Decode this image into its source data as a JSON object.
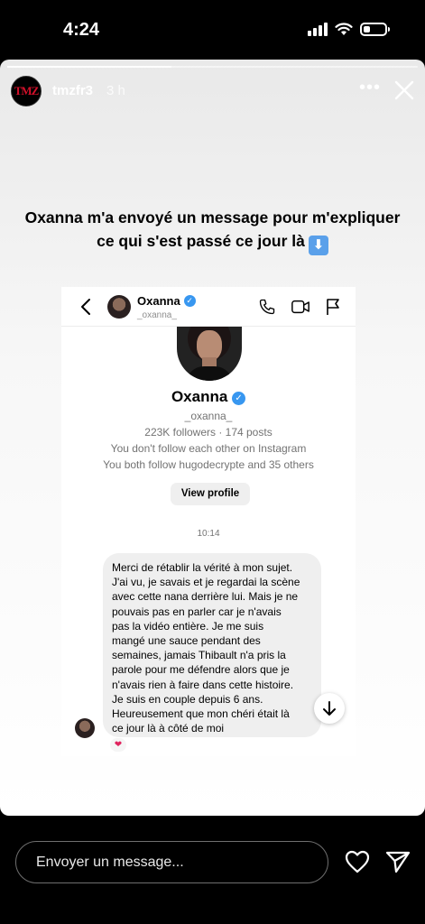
{
  "status_bar": {
    "time": "4:24"
  },
  "story": {
    "username": "tmzfr3",
    "time_ago": "3 h",
    "avatar_text": "TMZ",
    "more_label": "•••",
    "caption_text": "Oxanna m'a envoyé un message pour m'expliquer ce qui s'est passé ce jour là",
    "caption_emoji": "⬇"
  },
  "dm": {
    "top_name": "Oxanna",
    "top_handle": "_oxanna_",
    "profile_name": "Oxanna",
    "profile_handle": "_oxanna_",
    "stats": "223K followers · 174 posts",
    "mutual_line1": "You don't follow each other on Instagram",
    "mutual_line2": "You both follow hugodecrypte and 35 others",
    "view_profile_label": "View profile",
    "timestamp": "10:14",
    "message_lines": [
      "Merci de rétablir la vérité à mon sujet.",
      "J'ai vu, je savais et je regardai la scène",
      "avec cette nana derrière lui. Mais je ne",
      "pouvais pas en parler car je n'avais",
      "pas la vidéo entière. Je me suis",
      "mangé une sauce pendant des",
      "semaines, jamais Thibault n'a pris la",
      "parole pour me défendre alors que je",
      "n'avais rien à faire dans cette histoire.",
      "Je suis en couple depuis 6 ans.",
      "Heureusement que mon chéri était là",
      "ce jour là à côté de moi"
    ],
    "reaction": "❤"
  },
  "reply": {
    "placeholder": "Envoyer un message..."
  },
  "icons": {
    "close": "close-icon",
    "back": "chevron-left-icon",
    "phone": "phone-icon",
    "video": "video-camera-icon",
    "flag": "flag-icon",
    "heart": "heart-icon",
    "send": "send-icon",
    "arrow_down": "arrow-down-icon"
  },
  "colors": {
    "verified_blue": "#3897f0",
    "heart_red": "#e0245e",
    "bubble_gray": "#efefef"
  }
}
